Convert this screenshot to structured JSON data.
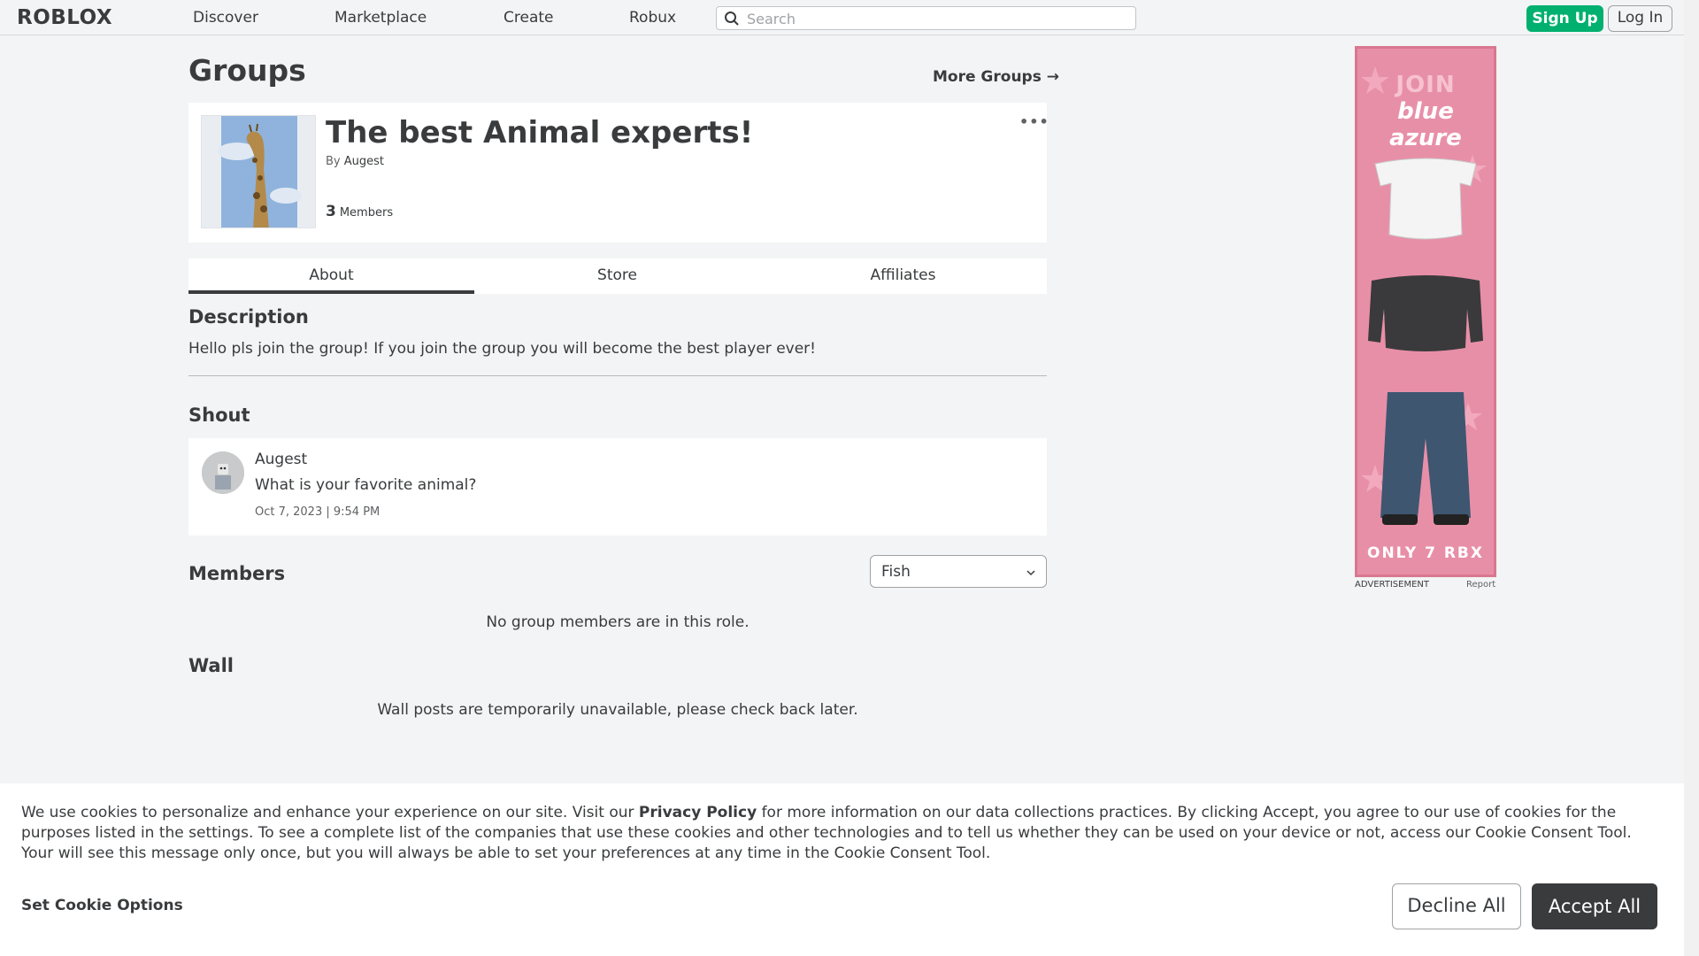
{
  "nav": {
    "logo": "ROBLOX",
    "links": [
      "Discover",
      "Marketplace",
      "Create",
      "Robux"
    ],
    "search_placeholder": "Search",
    "signup_label": "Sign Up",
    "login_label": "Log In"
  },
  "header": {
    "title": "Groups",
    "more_groups": "More Groups →"
  },
  "group": {
    "name": "The best Animal experts!",
    "by_label": "By",
    "owner": "Augest",
    "member_count": "3",
    "members_label": "Members"
  },
  "tabs": [
    {
      "label": "About",
      "active": true
    },
    {
      "label": "Store",
      "active": false
    },
    {
      "label": "Affiliates",
      "active": false
    }
  ],
  "description": {
    "title": "Description",
    "text": "Hello pls join the group! If you join the group you will become the best player ever!"
  },
  "shout": {
    "title": "Shout",
    "user": "Augest",
    "message": "What is your favorite animal?",
    "date": "Oct 7, 2023 | 9:54 PM"
  },
  "members": {
    "title": "Members",
    "role_selected": "Fish",
    "empty_text": "No group members are in this role."
  },
  "wall": {
    "title": "Wall",
    "text": "Wall posts are temporarily unavailable, please check back later."
  },
  "ad": {
    "join": "JOIN",
    "brand": "blue azure",
    "price": "ONLY 7 RBX",
    "label": "ADVERTISEMENT",
    "report": "Report"
  },
  "cookie": {
    "text_before": "We use cookies to personalize and enhance your experience on our site. Visit our ",
    "privacy_link": "Privacy Policy",
    "text_after": " for more information on our data collections practices. By clicking Accept, you agree to our use of cookies for the purposes listed in the settings. To see a complete list of the companies that use these cookies and other technologies and to tell us whether they can be used on your device or not, access our Cookie Consent Tool. Your will see this message only once, but you will always be able to set your preferences at any time in the Cookie Consent Tool.",
    "options_label": "Set Cookie Options",
    "decline_label": "Decline All",
    "accept_label": "Accept All"
  },
  "colors": {
    "signup_green": "#00b06f",
    "text_dark": "#393b3d",
    "page_bg": "#f2f4f5",
    "accept_bg": "#393b3d"
  }
}
